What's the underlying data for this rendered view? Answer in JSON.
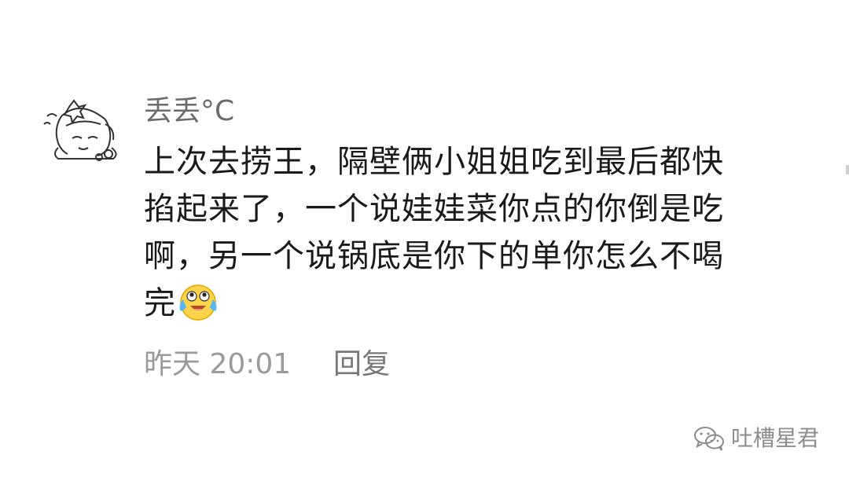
{
  "comment": {
    "username": "丢丢°C",
    "text_lines": [
      "上次去捞王，隔壁俩小姐姐吃到最后都快",
      "掐起来了，一个说娃娃菜你点的你倒是吃",
      "啊，另一个说锅底是你下的单你怎么不喝",
      "完"
    ],
    "emoji": "crying-laughing-emoji",
    "timestamp": "昨天 20:01",
    "reply_label": "回复"
  },
  "watermark": {
    "label": "吐槽星君",
    "icon": "wechat-icon"
  }
}
